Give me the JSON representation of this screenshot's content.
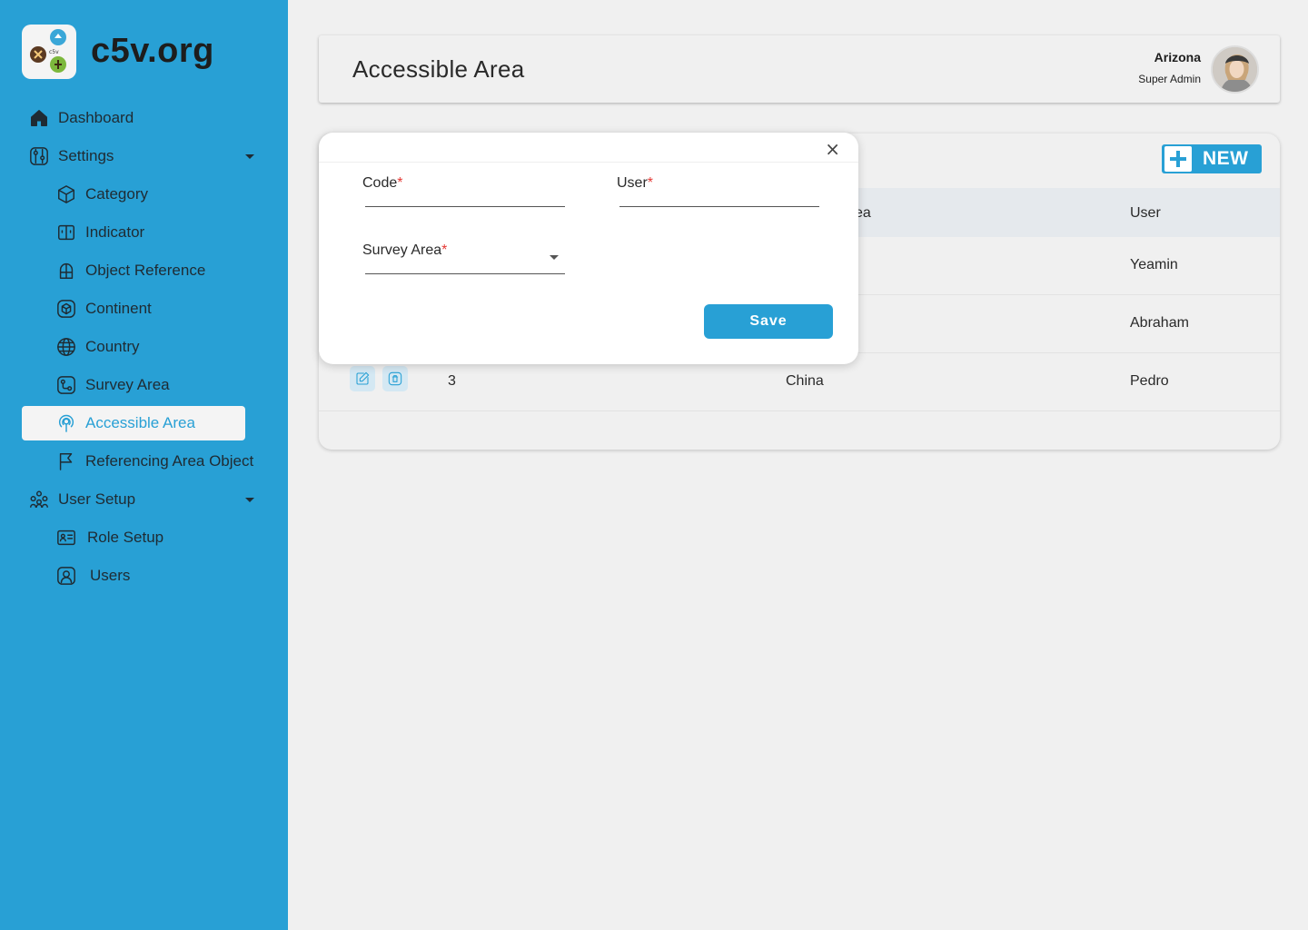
{
  "brand": {
    "name": "c5v.org"
  },
  "sidebar": {
    "items": [
      {
        "label": "Dashboard",
        "icon": "home-icon"
      },
      {
        "label": "Settings",
        "icon": "settings-icon"
      },
      {
        "label": "Category",
        "icon": "cube-icon"
      },
      {
        "label": "Indicator",
        "icon": "indicator-icon"
      },
      {
        "label": "Object Reference",
        "icon": "object-icon"
      },
      {
        "label": "Continent",
        "icon": "continent-icon"
      },
      {
        "label": "Country",
        "icon": "globe-icon"
      },
      {
        "label": "Survey Area",
        "icon": "survey-icon"
      },
      {
        "label": "Accessible Area",
        "icon": "location-icon"
      },
      {
        "label": "Referencing Area Object",
        "icon": "flag-icon"
      },
      {
        "label": "User Setup",
        "icon": "users-icon"
      },
      {
        "label": "Role Setup",
        "icon": "id-card-icon"
      },
      {
        "label": "Users",
        "icon": "user-icon"
      }
    ],
    "active": "Accessible Area"
  },
  "header": {
    "title": "Accessible Area",
    "user_name": "Arizona",
    "user_role": "Super Admin"
  },
  "table": {
    "new_label": "NEW",
    "columns": [
      "ea",
      "User"
    ],
    "rows": [
      {
        "code": "",
        "area": "",
        "user": "Yeamin"
      },
      {
        "code": "",
        "area": "",
        "user": "Abraham"
      },
      {
        "code": "3",
        "area": "China",
        "user": "Pedro"
      }
    ]
  },
  "modal": {
    "close": "×",
    "code_label": "Code",
    "user_label": "User",
    "survey_area_label": "Survey Area",
    "required_mark": "*",
    "save_label": "Save"
  },
  "colors": {
    "accent": "#28a0d5",
    "required": "#e53935"
  }
}
